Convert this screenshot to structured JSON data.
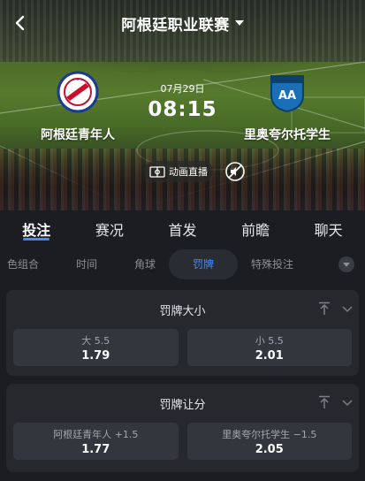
{
  "header": {
    "title": "阿根廷职业联赛"
  },
  "match": {
    "date": "07月29日",
    "time": "08:15",
    "home_team": "阿根廷青年人",
    "away_team": "里奥夸尔托学生",
    "live_label": "动画直播"
  },
  "tabs": [
    {
      "label": "投注",
      "active": true
    },
    {
      "label": "赛况"
    },
    {
      "label": "首发"
    },
    {
      "label": "前瞻"
    },
    {
      "label": "聊天"
    }
  ],
  "subtabs": [
    {
      "label": "色组合"
    },
    {
      "label": "时间"
    },
    {
      "label": "角球"
    },
    {
      "label": "罚牌",
      "active": true
    },
    {
      "label": "特殊投注"
    }
  ],
  "markets": [
    {
      "title": "罚牌大小",
      "options": [
        {
          "label": "大  5.5",
          "odds": "1.79"
        },
        {
          "label": "小  5.5",
          "odds": "2.01"
        }
      ]
    },
    {
      "title": "罚牌让分",
      "options": [
        {
          "label": "阿根廷青年人  +1.5",
          "odds": "1.77"
        },
        {
          "label": "里奥夸尔托学生  −1.5",
          "odds": "2.05"
        }
      ]
    }
  ],
  "colors": {
    "accent": "#3f8cff",
    "background": "#1c1d22",
    "card": "#26282e",
    "odd_button": "#34363d"
  },
  "icons": {
    "back": "back-arrow-icon",
    "pin": "pin-top-icon",
    "collapse": "chevron-down-icon",
    "live": "pitch-icon",
    "mute": "mute-icon"
  }
}
